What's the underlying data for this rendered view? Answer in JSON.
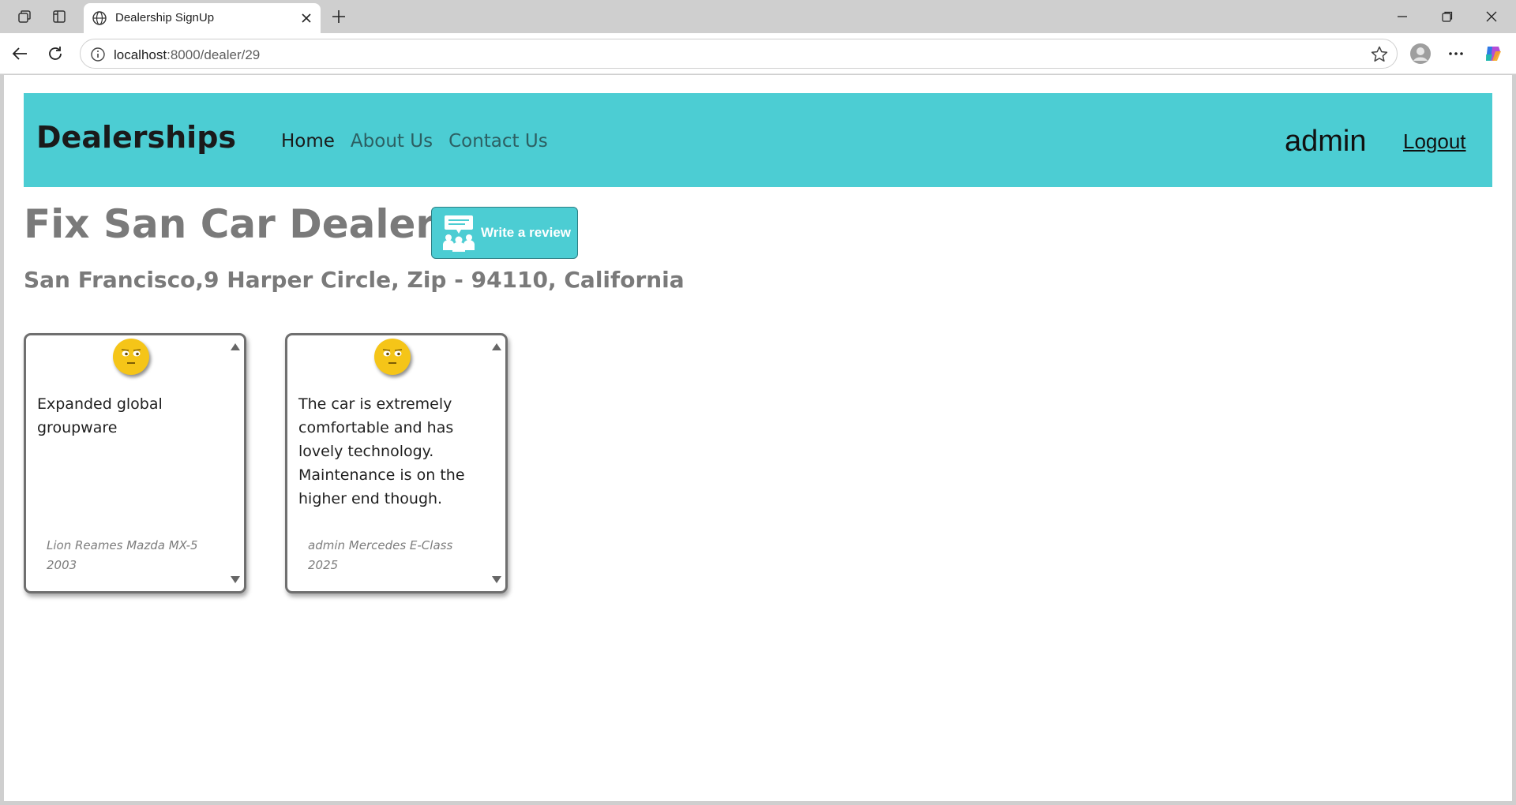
{
  "browser": {
    "tab_title": "Dealership SignUp",
    "url_host": "localhost",
    "url_path": ":8000/dealer/29"
  },
  "navbar": {
    "brand": "Dealerships",
    "links": [
      {
        "label": "Home",
        "active": true
      },
      {
        "label": "About Us",
        "active": false
      },
      {
        "label": "Contact Us",
        "active": false
      }
    ],
    "user": "admin",
    "logout": "Logout",
    "color": "#4ccdd3"
  },
  "dealer": {
    "name": "Fix San Car Dealership",
    "address": "San Francisco,9 Harper Circle, Zip - 94110, California",
    "write_review_label": "Write a review"
  },
  "reviews": [
    {
      "sentiment": "neutral-face-icon",
      "text": "Expanded global groupware",
      "author_line1": "Lion Reames Mazda MX-5",
      "author_line2": "2003"
    },
    {
      "sentiment": "neutral-face-icon",
      "text": "The car is extremely comfortable and has lovely technology. Maintenance is on the higher end though.",
      "author_line1": "admin Mercedes E-Class",
      "author_line2": "2025"
    }
  ]
}
